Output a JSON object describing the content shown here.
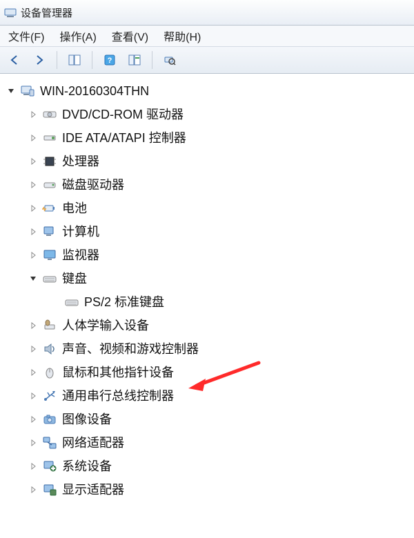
{
  "title": "设备管理器",
  "menu": {
    "file": "文件(F)",
    "action": "操作(A)",
    "view": "查看(V)",
    "help": "帮助(H)"
  },
  "toolbar": {
    "back": "back-arrow",
    "forward": "forward-arrow",
    "show": "show-hide",
    "help": "help",
    "prop": "properties",
    "search": "search"
  },
  "tree": {
    "root": {
      "label": "WIN-20160304THN",
      "expanded": true,
      "icon": "computer",
      "children": [
        {
          "label": "DVD/CD-ROM 驱动器",
          "icon": "disc",
          "expanded": false
        },
        {
          "label": "IDE ATA/ATAPI 控制器",
          "icon": "ide",
          "expanded": false
        },
        {
          "label": "处理器",
          "icon": "cpu",
          "expanded": false
        },
        {
          "label": "磁盘驱动器",
          "icon": "hdd",
          "expanded": false
        },
        {
          "label": "电池",
          "icon": "battery",
          "expanded": false
        },
        {
          "label": "计算机",
          "icon": "pc",
          "expanded": false
        },
        {
          "label": "监视器",
          "icon": "monitor",
          "expanded": false
        },
        {
          "label": "键盘",
          "icon": "keyboard",
          "expanded": true,
          "children": [
            {
              "label": "PS/2 标准键盘",
              "icon": "keyboard"
            }
          ]
        },
        {
          "label": "人体学输入设备",
          "icon": "hid",
          "expanded": false
        },
        {
          "label": "声音、视频和游戏控制器",
          "icon": "sound",
          "expanded": false
        },
        {
          "label": "鼠标和其他指针设备",
          "icon": "mouse",
          "expanded": false
        },
        {
          "label": "通用串行总线控制器",
          "icon": "usb",
          "expanded": false
        },
        {
          "label": "图像设备",
          "icon": "image",
          "expanded": false
        },
        {
          "label": "网络适配器",
          "icon": "network",
          "expanded": false
        },
        {
          "label": "系统设备",
          "icon": "system",
          "expanded": false
        },
        {
          "label": "显示适配器",
          "icon": "display",
          "expanded": false
        }
      ]
    }
  }
}
